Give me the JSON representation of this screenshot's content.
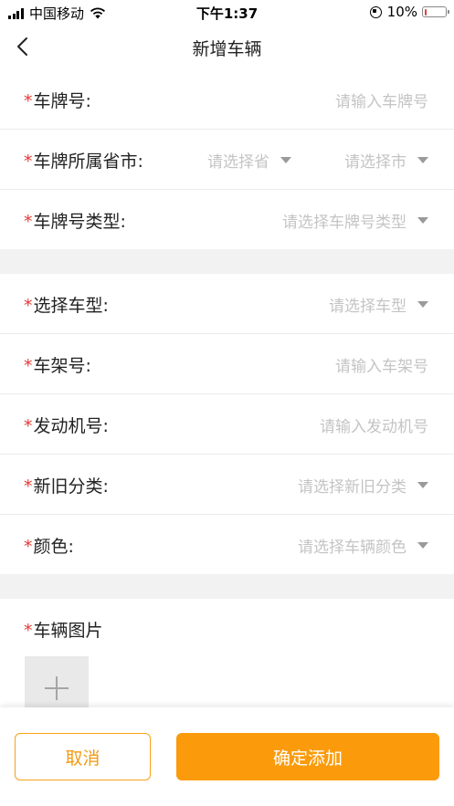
{
  "status_bar": {
    "carrier": "中国移动",
    "time": "下午1:37",
    "battery": "10%",
    "battery_level": 0.1
  },
  "nav": {
    "title": "新增车辆"
  },
  "form": {
    "required_mark": "*",
    "plate_number": {
      "label": "车牌号:",
      "placeholder": "请输入车牌号"
    },
    "plate_region": {
      "label": "车牌所属省市:",
      "province_placeholder": "请选择省",
      "city_placeholder": "请选择市"
    },
    "plate_type": {
      "label": "车牌号类型:",
      "placeholder": "请选择车牌号类型"
    },
    "vehicle_model": {
      "label": "选择车型:",
      "placeholder": "请选择车型"
    },
    "frame_number": {
      "label": "车架号:",
      "placeholder": "请输入车架号"
    },
    "engine_number": {
      "label": "发动机号:",
      "placeholder": "请输入发动机号"
    },
    "condition": {
      "label": "新旧分类:",
      "placeholder": "请选择新旧分类"
    },
    "color": {
      "label": "颜色:",
      "placeholder": "请选择车辆颜色"
    },
    "photos": {
      "label": "车辆图片"
    }
  },
  "footer": {
    "cancel_label": "取消",
    "confirm_label": "确定添加"
  },
  "colors": {
    "accent": "#fb9b0c",
    "required": "#e53935",
    "placeholder": "#c4c4c4",
    "divider": "#f2f2f2"
  }
}
